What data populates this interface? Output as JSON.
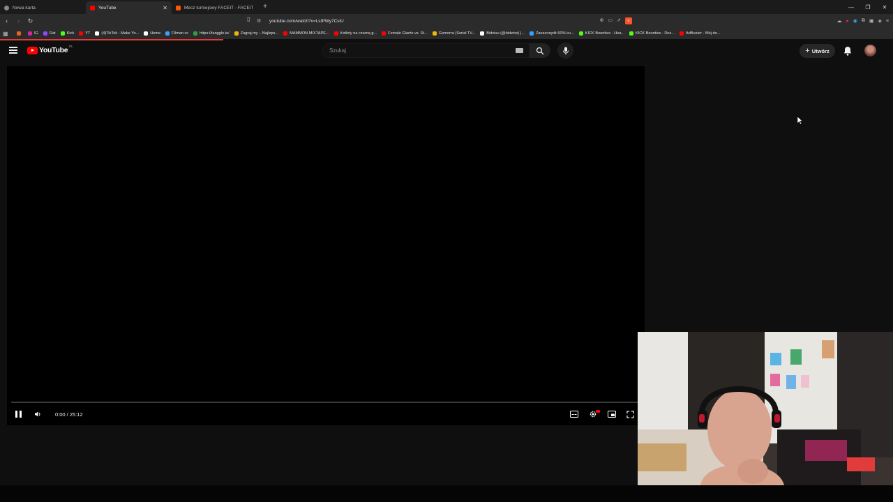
{
  "browser": {
    "tabs": [
      {
        "label": "Nowa karta",
        "favicon_color": "#8a8a8a",
        "active": false
      },
      {
        "label": "YouTube",
        "favicon_color": "#ff0000",
        "active": true
      },
      {
        "label": "Mecz turniejowy FACEIT - FACEIT.com",
        "favicon_color": "#ff5500",
        "active": false
      }
    ],
    "new_tab_icon": "plus-icon",
    "url": "youtube.com/watch?v=LsIPWy7CslU",
    "bookmarks": [
      {
        "label": "",
        "color": "#e8641b"
      },
      {
        "label": "IG",
        "color": "#d6249f"
      },
      {
        "label": "Rat",
        "color": "#9147ff"
      },
      {
        "label": "Kick",
        "color": "#53fc18"
      },
      {
        "label": "YT",
        "color": "#ff0000"
      },
      {
        "label": "(4)TikTok - Make Yo...",
        "color": "#ffffff"
      },
      {
        "label": "Home",
        "color": "#ffffff"
      },
      {
        "label": "Filman.cc",
        "color": "#3aa0ff"
      },
      {
        "label": "https://tanggle.io/",
        "color": "#2f9e44"
      },
      {
        "label": "Zagraj.my – Najleps...",
        "color": "#f2b705"
      },
      {
        "label": "MAMMON MIXTAPE...",
        "color": "#ff0000"
      },
      {
        "label": "Kotlety na czarną g...",
        "color": "#ff0000"
      },
      {
        "label": "Female Giants vs. St...",
        "color": "#ff0000"
      },
      {
        "label": "Gomorra (Serial TV...",
        "color": "#f2b705"
      },
      {
        "label": "Bidziuu (@bidzioo) |...",
        "color": "#ffffff"
      },
      {
        "label": "Zaoszczędź 60% ku...",
        "color": "#3aa0ff"
      },
      {
        "label": "KICK Bounties - Hea...",
        "color": "#53fc18"
      },
      {
        "label": "KICK Bounties - Des...",
        "color": "#53fc18"
      },
      {
        "label": "AdBuster - Mój do...",
        "color": "#ff0000"
      }
    ]
  },
  "youtube": {
    "logo_text": "YouTube",
    "country_code": "PL",
    "search_placeholder": "Szukaj",
    "create_label": "Utwórz",
    "accent": "#ff0000"
  },
  "player": {
    "time": "0:00 / 25:12",
    "progress": 0.0
  }
}
